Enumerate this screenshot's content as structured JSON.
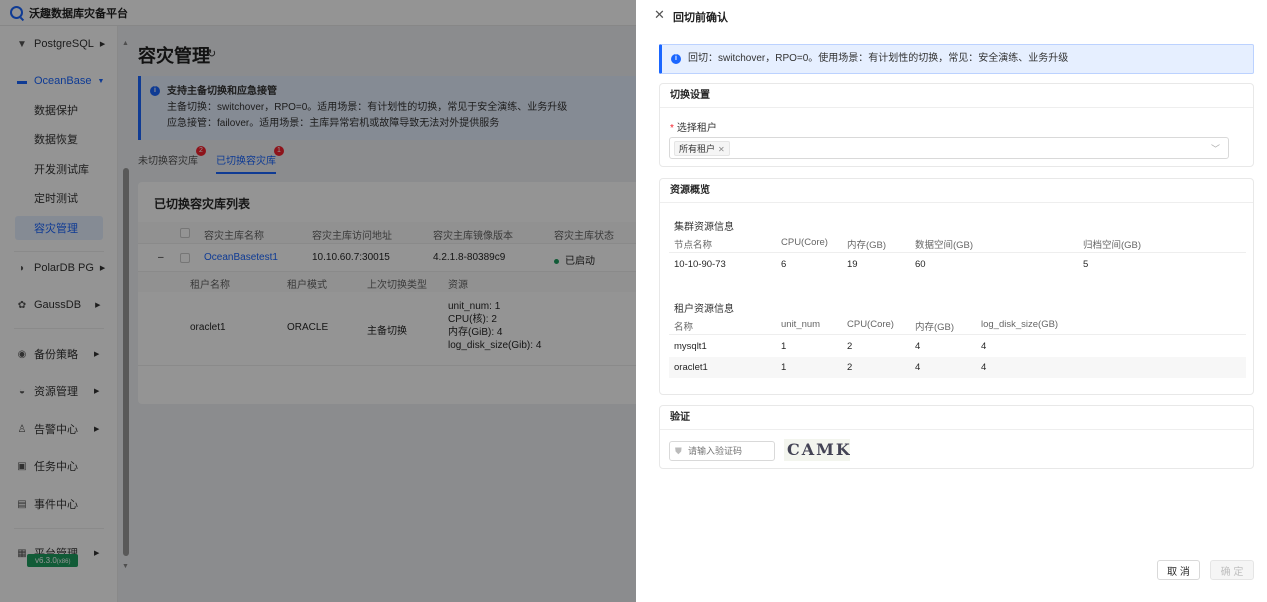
{
  "app": {
    "title": "沃趣数据库灾备平台",
    "version": "v6.3.0",
    "version_arch": "(x86)"
  },
  "sidebar": {
    "items": [
      {
        "label": "PostgreSQL",
        "icon": "elephant-icon"
      },
      {
        "label": "OceanBase",
        "icon": "database-icon"
      },
      {
        "label": "数据保护"
      },
      {
        "label": "数据恢复"
      },
      {
        "label": "开发测试库"
      },
      {
        "label": "定时测试"
      },
      {
        "label": "容灾管理"
      },
      {
        "label": "PolarDB PG",
        "icon": "polardb-icon"
      },
      {
        "label": "GaussDB",
        "icon": "gaussdb-icon"
      },
      {
        "label": "备份策略",
        "icon": "shield-icon"
      },
      {
        "label": "资源管理",
        "icon": "resource-icon"
      },
      {
        "label": "告警中心",
        "icon": "alarm-icon"
      },
      {
        "label": "任务中心",
        "icon": "task-icon"
      },
      {
        "label": "事件中心",
        "icon": "event-icon"
      },
      {
        "label": "平台管理",
        "icon": "platform-icon"
      }
    ]
  },
  "main": {
    "title": "容灾管理",
    "info": {
      "heading": "支持主备切换和应急接管",
      "line1": "主备切换：switchover，RPO=0。适用场景：有计划性的切换，常见于安全演练、业务升级",
      "line2": "应急接管：failover。适用场景：主库异常宕机或故障导致无法对外提供服务"
    },
    "tabs": [
      {
        "label": "未切换容灾库",
        "badge": "2"
      },
      {
        "label": "已切换容灾库",
        "badge": "1"
      }
    ],
    "card_title": "已切换容灾库列表",
    "columns": [
      "容灾主库名称",
      "容灾主库访问地址",
      "容灾主库镜像版本",
      "容灾主库状态"
    ],
    "row": {
      "expand": "–",
      "name": "OceanBasetest1",
      "address": "10.10.60.7:30015",
      "version": "4.2.1.8-80389c9",
      "status": "已启动"
    },
    "sub_columns": [
      "租户名称",
      "租户模式",
      "上次切换类型",
      "资源"
    ],
    "sub_row": {
      "tenant": "oraclet1",
      "mode": "ORACLE",
      "switch_type": "主备切换",
      "resources": [
        "unit_num: 1",
        "CPU(核): 2",
        "内存(GiB): 4",
        "log_disk_size(Gib): 4"
      ]
    }
  },
  "drawer": {
    "title": "回切前确认",
    "alert": "回切：switchover，RPO=0。使用场景：有计划性的切换，常见：安全演练、业务升级",
    "switch_settings": {
      "title": "切换设置",
      "tenant_label": "选择租户",
      "selected_tag": "所有租户"
    },
    "resource_overview": {
      "title": "资源概览",
      "cluster_title": "集群资源信息",
      "cluster_columns": [
        "节点名称",
        "CPU(Core)",
        "内存(GB)",
        "数据空间(GB)",
        "归档空间(GB)"
      ],
      "cluster_rows": [
        [
          "10-10-90-73",
          "6",
          "19",
          "60",
          "5"
        ]
      ],
      "tenant_title": "租户资源信息",
      "tenant_columns": [
        "名称",
        "unit_num",
        "CPU(Core)",
        "内存(GB)",
        "log_disk_size(GB)"
      ],
      "tenant_rows": [
        [
          "mysqlt1",
          "1",
          "2",
          "4",
          "4"
        ],
        [
          "oraclet1",
          "1",
          "2",
          "4",
          "4"
        ]
      ]
    },
    "verify": {
      "title": "验证",
      "placeholder": "请输入验证码",
      "captcha": "CAMK"
    },
    "buttons": {
      "cancel": "取 消",
      "ok": "确 定"
    }
  },
  "colors": {
    "primary": "#1a66ff",
    "success": "#1e9e60",
    "danger": "#f5222d",
    "version_badge": "#1e9e60"
  }
}
